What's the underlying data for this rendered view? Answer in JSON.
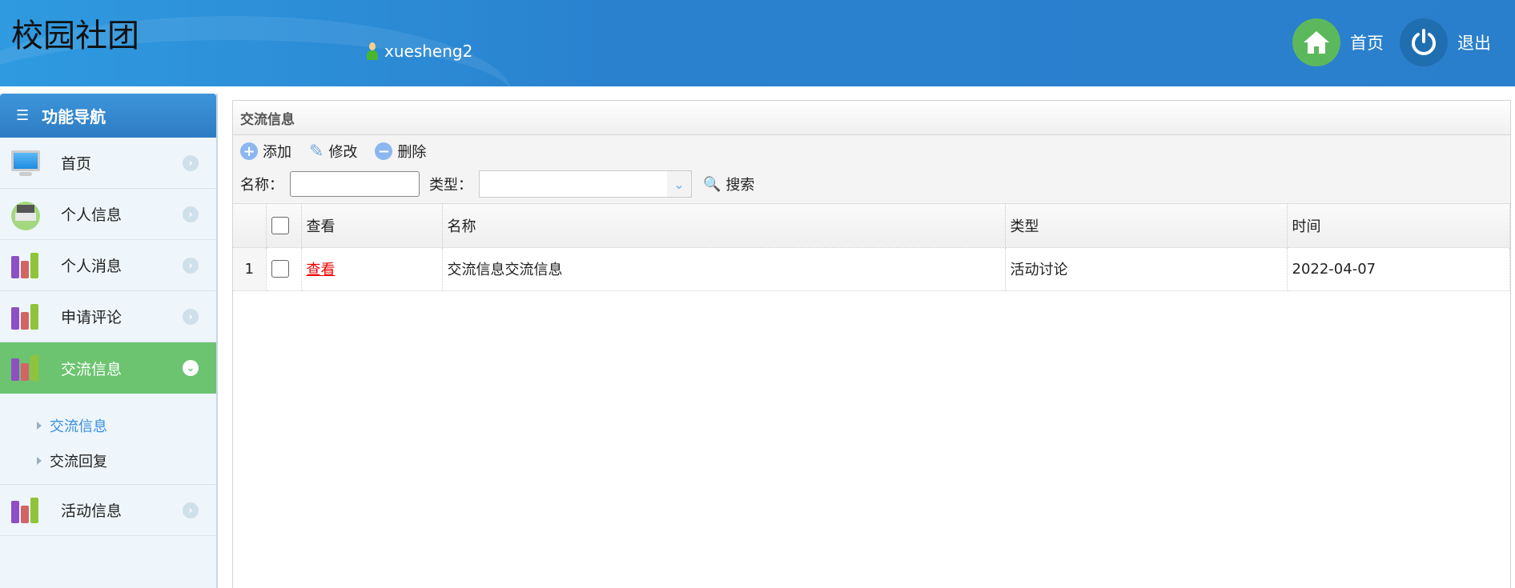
{
  "header": {
    "title": "校园社团",
    "username": "xuesheng2",
    "home_label": "首页",
    "logout_label": "退出"
  },
  "sidebar": {
    "title": "功能导航",
    "items": [
      {
        "label": "首页",
        "icon": "monitor-icon"
      },
      {
        "label": "个人信息",
        "icon": "printer-icon"
      },
      {
        "label": "个人消息",
        "icon": "books-icon"
      },
      {
        "label": "申请评论",
        "icon": "books-icon"
      },
      {
        "label": "交流信息",
        "icon": "books-icon",
        "active": true
      },
      {
        "label": "活动信息",
        "icon": "books-icon"
      }
    ],
    "subitems": [
      {
        "label": "交流信息",
        "active": true
      },
      {
        "label": "交流回复"
      }
    ]
  },
  "panel": {
    "title": "交流信息",
    "toolbar": {
      "add": "添加",
      "edit": "修改",
      "delete": "删除"
    },
    "search": {
      "name_label": "名称：",
      "name_value": "",
      "type_label": "类型：",
      "type_value": "",
      "search": "搜索"
    },
    "columns": [
      "查看",
      "名称",
      "类型",
      "时间"
    ],
    "rows": [
      {
        "num": "1",
        "view": "查看",
        "name": "交流信息交流信息",
        "type": "活动讨论",
        "time": "2022-04-07"
      }
    ]
  },
  "colors": {
    "header": "#2a82cf",
    "active": "#6cc470",
    "link": "#e00000"
  }
}
